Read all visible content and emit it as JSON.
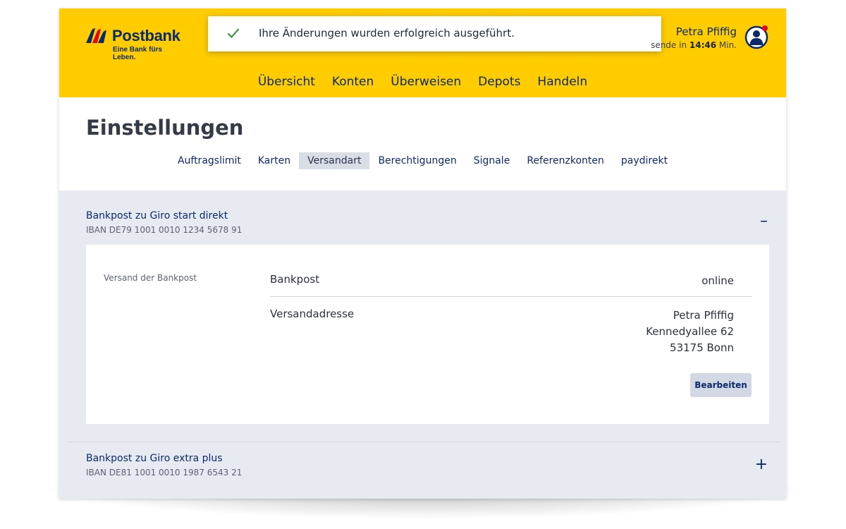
{
  "brand": {
    "name": "Postbank",
    "claim": "Eine Bank fürs Leben.",
    "colors": {
      "yellow": "#ffcc00",
      "navy": "#0b2a6b",
      "red": "#e30613"
    }
  },
  "toast": {
    "icon": "check-icon",
    "message": "Ihre Änderungen wurden erfolgreich ausgeführt."
  },
  "user": {
    "name": "Petra Pfiffig",
    "session_prefix": "sende in ",
    "session_time": "14:46",
    "session_suffix": " Min.",
    "avatar_icon": "user-avatar-icon"
  },
  "main_nav": [
    "Übersicht",
    "Konten",
    "Überweisen",
    "Depots",
    "Handeln"
  ],
  "page": {
    "title": "Einstellungen",
    "tabs": [
      {
        "label": "Auftragslimit",
        "active": false
      },
      {
        "label": "Karten",
        "active": false
      },
      {
        "label": "Versandart",
        "active": true
      },
      {
        "label": "Berechtigungen",
        "active": false
      },
      {
        "label": "Signale",
        "active": false
      },
      {
        "label": "Referenzkonten",
        "active": false
      },
      {
        "label": "paydirekt",
        "active": false
      }
    ]
  },
  "accounts": [
    {
      "title": "Bankpost zu Giro start direkt",
      "iban": "IBAN DE79 1001 0010 1234 5678 91",
      "toggle": "–",
      "expanded": true,
      "details": {
        "section_label": "Versand der Bankpost",
        "rows": [
          {
            "key": "Bankpost",
            "value": [
              "online"
            ]
          },
          {
            "key": "Versandadresse",
            "value": [
              "Petra Pfiffig",
              "Kennedyallee 62",
              "53175 Bonn"
            ]
          }
        ],
        "edit_label": "Bearbeiten"
      }
    },
    {
      "title": "Bankpost zu Giro extra plus",
      "iban": "IBAN DE81 1001 0010 1987 6543 21",
      "toggle": "+",
      "expanded": false
    }
  ]
}
